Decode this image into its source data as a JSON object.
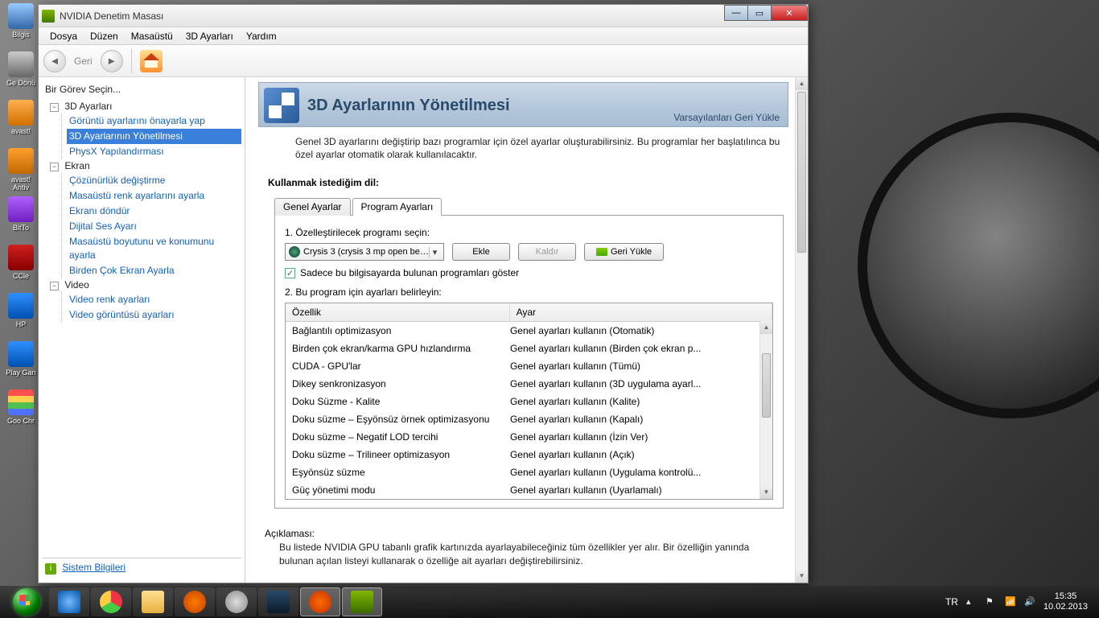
{
  "window": {
    "title": "NVIDIA Denetim Masası",
    "menu": [
      "Dosya",
      "Düzen",
      "Masaüstü",
      "3D Ayarları",
      "Yardım"
    ],
    "back_label": "Geri"
  },
  "sidebar": {
    "task_title": "Bir Görev Seçin...",
    "nodes": [
      {
        "label": "3D Ayarları",
        "children": [
          "Görüntü ayarlarını önayarla yap",
          "3D Ayarlarının Yönetilmesi",
          "PhysX Yapılandırması"
        ],
        "selected_index": 1
      },
      {
        "label": "Ekran",
        "children": [
          "Çözünürlük değiştirme",
          "Masaüstü renk ayarlarını ayarla",
          "Ekranı döndür",
          "Dijital Ses Ayarı",
          "Masaüstü boyutunu ve konumunu ayarla",
          "Birden Çok Ekran Ayarla"
        ]
      },
      {
        "label": "Video",
        "children": [
          "Video renk ayarları",
          "Video görüntüsü ayarları"
        ]
      }
    ],
    "system_info": "Sistem Bilgileri"
  },
  "page": {
    "title": "3D Ayarlarının Yönetilmesi",
    "restore": "Varsayılanları Geri Yükle",
    "description": "Genel 3D ayarlarını değiştirip bazı programlar için özel ayarlar oluşturabilirsiniz. Bu programlar her başlatılınca bu özel ayarlar otomatik olarak kullanılacaktır.",
    "section_title": "Kullanmak istediğim dil:",
    "tabs": {
      "global": "Genel Ayarlar",
      "program": "Program Ayarları"
    },
    "step1": "1. Özelleştirilecek programı seçin:",
    "program_selected": "Crysis 3 (crysis 3 mp open beta...",
    "btn_add": "Ekle",
    "btn_remove": "Kaldır",
    "btn_restore": "Geri Yükle",
    "chk_label": "Sadece bu bilgisayarda bulunan programları göster",
    "step2": "2. Bu program için ayarları belirleyin:",
    "col_feature": "Özellik",
    "col_setting": "Ayar",
    "rows": [
      {
        "f": "Bağlantılı optimizasyon",
        "s": "Genel ayarları kullanın (Otomatik)"
      },
      {
        "f": "Birden çok ekran/karma GPU hızlandırma",
        "s": "Genel ayarları kullanın (Birden çok ekran p..."
      },
      {
        "f": "CUDA - GPU'lar",
        "s": "Genel ayarları kullanın (Tümü)"
      },
      {
        "f": "Dikey senkronizasyon",
        "s": "Genel ayarları kullanın (3D uygulama ayarl..."
      },
      {
        "f": "Doku Süzme - Kalite",
        "s": "Genel ayarları kullanın (Kalite)"
      },
      {
        "f": "Doku süzme – Eşyönsüz örnek optimizasyonu",
        "s": "Genel ayarları kullanın (Kapalı)"
      },
      {
        "f": "Doku süzme – Negatif LOD tercihi",
        "s": "Genel ayarları kullanın (İzin Ver)"
      },
      {
        "f": "Doku süzme – Trilineer optimizasyon",
        "s": "Genel ayarları kullanın (Açık)"
      },
      {
        "f": "Eşyönsüz süzme",
        "s": "Genel ayarları kullanın (Uygulama kontrolü..."
      },
      {
        "f": "Güç yönetimi modu",
        "s": "Genel ayarları kullanın (Uyarlamalı)"
      }
    ],
    "explain_title": "Açıklaması:",
    "explain_body": "Bu listede NVIDIA GPU tabanlı grafik kartınızda ayarlayabileceğiniz tüm özellikler yer alır. Bir özelliğin yanında bulunan açılan listeyi kullanarak o özelliğe ait ayarları değiştirebilirsiniz."
  },
  "desktop_icons": [
    "Bilgis",
    "Ge Dönü",
    "avast!",
    "avast! Antiv",
    "BitTo",
    "CCle",
    "HP",
    "Play Gan",
    "Goo Chr"
  ],
  "taskbar": {
    "lang": "TR",
    "time": "15:35",
    "date": "10.02.2013"
  }
}
